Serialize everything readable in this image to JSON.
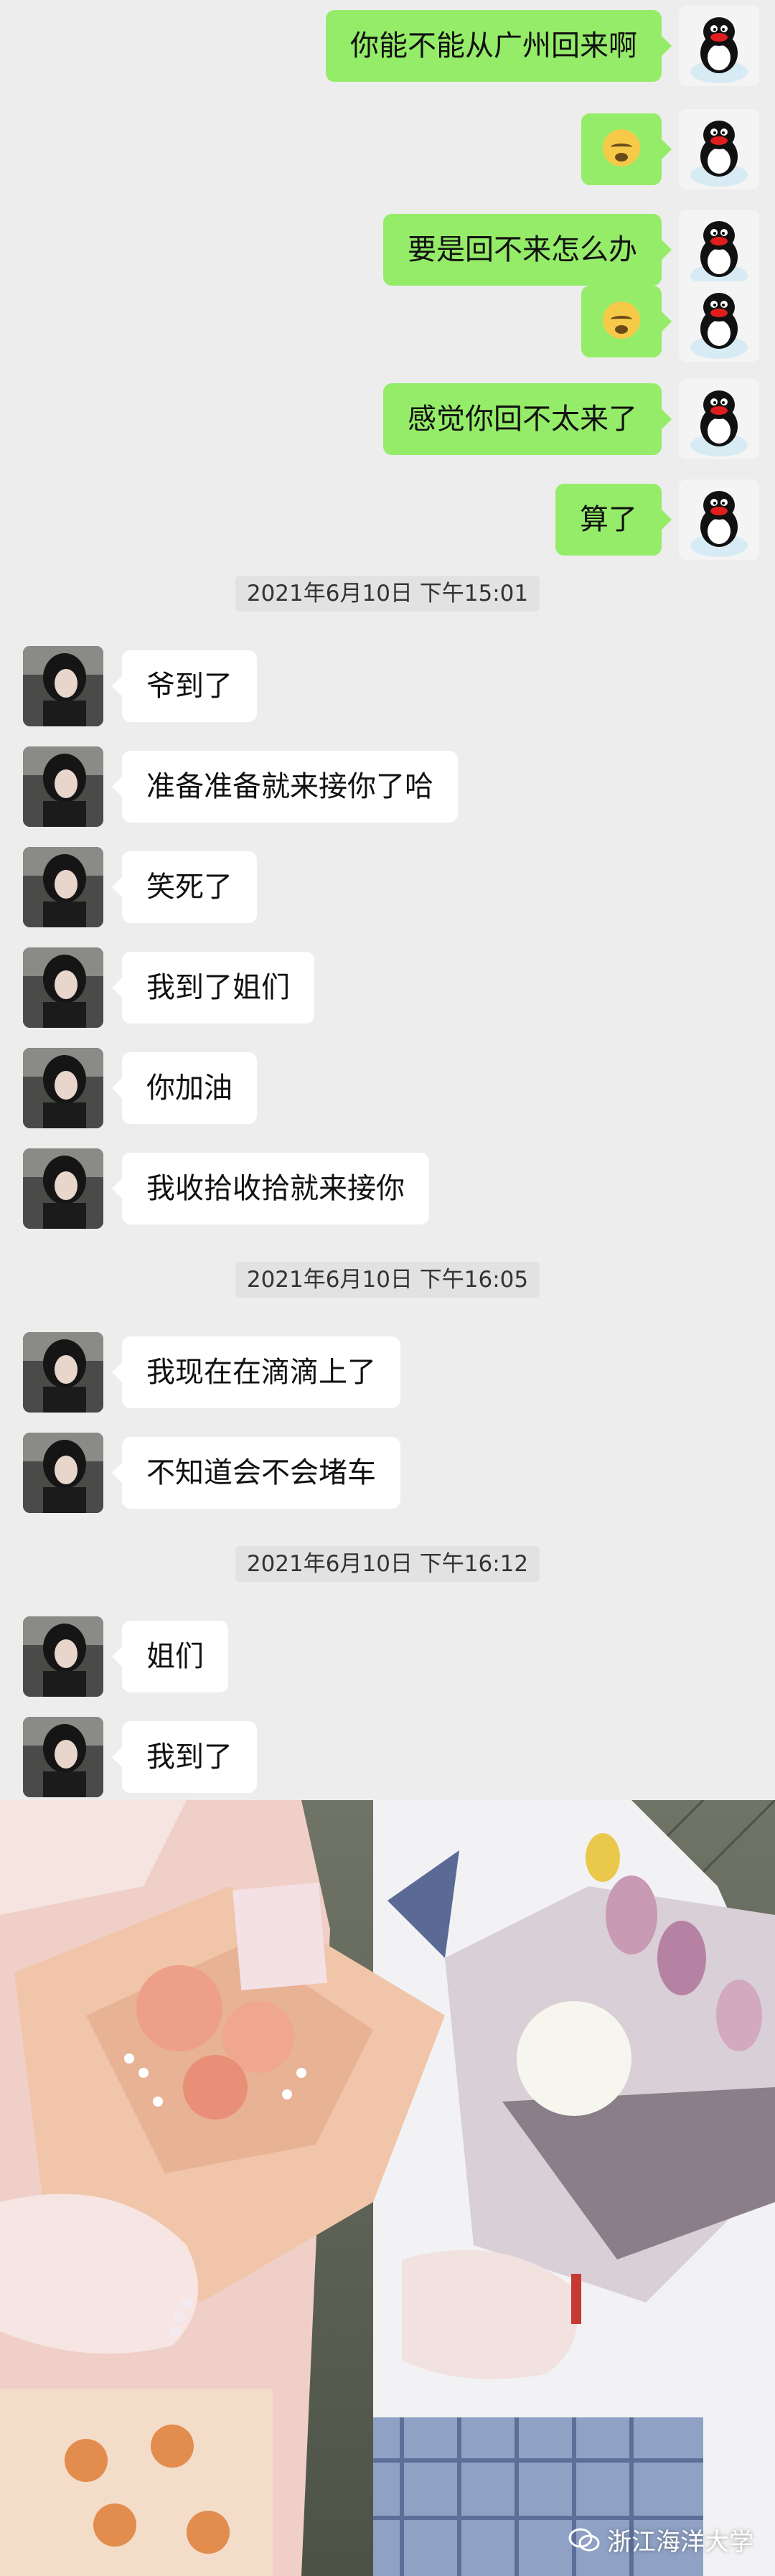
{
  "messages_before": [
    {
      "from": "me",
      "text": "你能不能从广州回来啊"
    },
    {
      "from": "me",
      "emoji": "sad-face-emoji"
    },
    {
      "from": "me",
      "text": "要是回不来怎么办"
    },
    {
      "from": "me",
      "emoji": "sad-face-emoji"
    },
    {
      "from": "me",
      "text": "感觉你回不太来了"
    },
    {
      "from": "me",
      "text": "算了"
    }
  ],
  "timestamps": [
    "2021年6月10日 下午15:01",
    "2021年6月10日 下午16:05",
    "2021年6月10日 下午16:12"
  ],
  "group1": [
    "爷到了",
    "准备准备就来接你了哈",
    "笑死了",
    "我到了姐们",
    "你加油",
    "我收拾收拾就来接你"
  ],
  "group2": [
    "我现在在滴滴上了",
    "不知道会不会堵车"
  ],
  "group3": [
    "姐们",
    "我到了"
  ],
  "watermark": "浙江海洋大学",
  "colors": {
    "background": "#ededed",
    "my_bubble": "#95ec69",
    "their_bubble": "#ffffff"
  },
  "icons": {
    "my_avatar": "penguin-avatar-icon",
    "their_avatar": "girl-photo-avatar",
    "watermark": "wechat-official-account-icon"
  }
}
